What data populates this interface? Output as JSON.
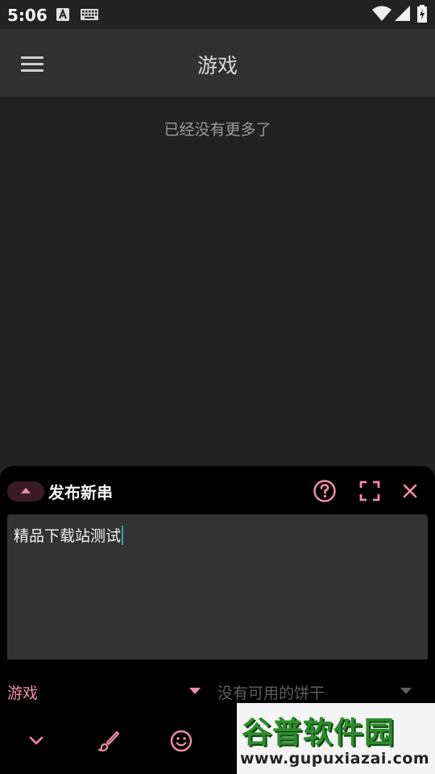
{
  "status_bar": {
    "time": "5:06"
  },
  "app_bar": {
    "title": "游戏"
  },
  "feed": {
    "empty_message": "已经没有更多了"
  },
  "composer": {
    "title": "发布新串",
    "content_value": "精品下载站测试",
    "board_selected": "游戏",
    "cookie_placeholder": "没有可用的饼干"
  },
  "watermark": {
    "brand": "谷普软件园",
    "url": "www.gupuxiazai.com"
  },
  "colors": {
    "accent": "#f48ca9",
    "background": "#222222",
    "app_bar": "#313131",
    "sheet": "#000000",
    "input": "#333333"
  },
  "icons": [
    "a-notification-icon",
    "keyboard-icon",
    "wifi-icon",
    "signal-icon",
    "battery-icon",
    "menu-icon",
    "chevron-up-icon",
    "help-icon",
    "fullscreen-icon",
    "close-icon",
    "dropdown-arrow-icon",
    "chevron-down-icon",
    "brush-icon",
    "emoji-icon"
  ]
}
